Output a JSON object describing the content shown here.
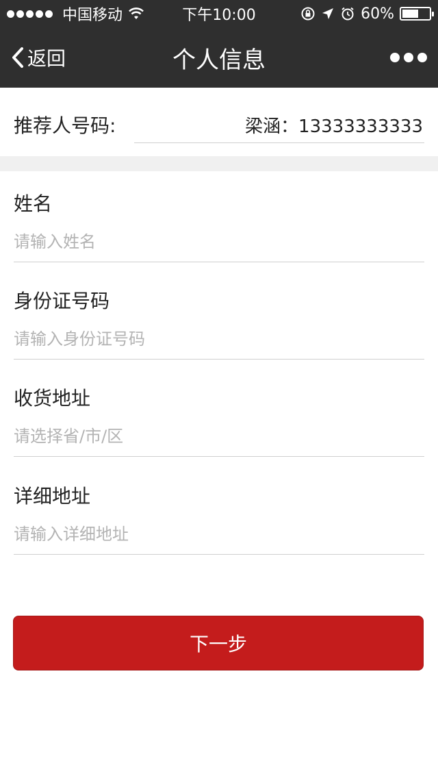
{
  "status_bar": {
    "carrier": "中国移动",
    "time": "下午10:00",
    "battery": "60%",
    "battery_level": 0.6
  },
  "nav": {
    "back_label": "返回",
    "title": "个人信息"
  },
  "referrer": {
    "label": "推荐人号码:",
    "value": "梁涵：13333333333"
  },
  "fields": [
    {
      "label": "姓名",
      "placeholder": "请输入姓名"
    },
    {
      "label": "身份证号码",
      "placeholder": "请输入身份证号码"
    },
    {
      "label": "收货地址",
      "placeholder": "请选择省/市/区"
    },
    {
      "label": "详细地址",
      "placeholder": "请输入详细地址"
    }
  ],
  "next_button": "下一步",
  "colors": {
    "bar_bg": "#2f2f2f",
    "accent": "#c41c1c",
    "placeholder": "#b3b3b3"
  }
}
